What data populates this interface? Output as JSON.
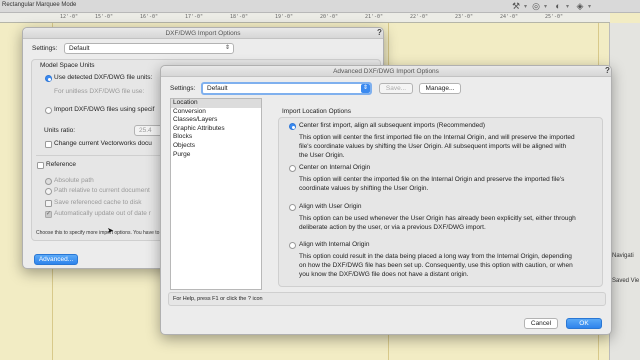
{
  "app": {
    "mode_label": "Rectangular Marquee Mode",
    "ruler_ticks": [
      "12'-0\"",
      "15'-0\"",
      "16'-0\"",
      "17'-0\"",
      "18'-0\"",
      "19'-0\"",
      "20'-0\"",
      "21'-0\"",
      "22'-0\"",
      "23'-0\"",
      "24'-0\"",
      "25'-0\""
    ]
  },
  "right_panel": {
    "tab_label": "Navigati",
    "saved_label": "Saved Vie"
  },
  "dxf_dialog": {
    "title": "DXF/DWG Import Options",
    "help": "?",
    "settings_label": "Settings:",
    "settings_value": "Default",
    "model_space_title": "Model Space Units",
    "use_detected_label": "Use detected DXF/DWG file units:",
    "unitless_label": "For unitless DXF/DWG file use:",
    "import_units_label": "Import DXF/DWG files using specif",
    "units_ratio_label": "Units ratio:",
    "units_ratio_value": "25.4",
    "change_current_label": "Change current Vectorworks docu",
    "reference_label": "Reference",
    "absolute_path_label": "Absolute path",
    "relative_path_label": "Path relative to current document",
    "save_cache_label": "Save referenced cache to disk",
    "auto_update_label": "Automatically update out of date r",
    "footer_note": "Choose this to specify more import options. You have to",
    "advanced_button": "Advanced..."
  },
  "adv_dialog": {
    "title": "Advanced DXF/DWG Import Options",
    "help": "?",
    "settings_label": "Settings:",
    "settings_value": "Default",
    "save_button": "Save...",
    "manage_button": "Manage...",
    "categories": [
      "Location",
      "Conversion",
      "Classes/Layers",
      "Graphic Attributes",
      "Blocks",
      "Objects",
      "Purge"
    ],
    "selected_category": "Location",
    "section_title": "Import Location Options",
    "options": [
      {
        "label": "Center first import, align all subsequent imports (Recommended)",
        "selected": true,
        "desc": [
          "This option will center the first imported file on the Internal Origin, and will preserve the imported",
          "file's coordinate values by shifting the User Origin. All subsequent imports will be aligned with",
          "the User Origin."
        ]
      },
      {
        "label": "Center on Internal Origin",
        "selected": false,
        "desc": [
          "This option will center the imported file on the Internal Origin and preserve the imported file's",
          "coordinate values by shifting the User Origin."
        ]
      },
      {
        "label": "Align with User Origin",
        "selected": false,
        "desc": [
          "This option can be used whenever the User Origin has already been explicitly set, either through",
          "deliberate action by the user, or via a previous DXF/DWG import."
        ]
      },
      {
        "label": "Align with Internal Origin",
        "selected": false,
        "desc": [
          "This option could result in the data being placed a long way from the Internal Origin, depending",
          "on how the DXF/DWG file has been set up. Consequently, use this option with caution, or when",
          "you know the DXF/DWG file does not have a distant origin."
        ]
      }
    ],
    "help_text": "For Help, press F1 or click the ? icon",
    "cancel_button": "Cancel",
    "ok_button": "OK"
  }
}
